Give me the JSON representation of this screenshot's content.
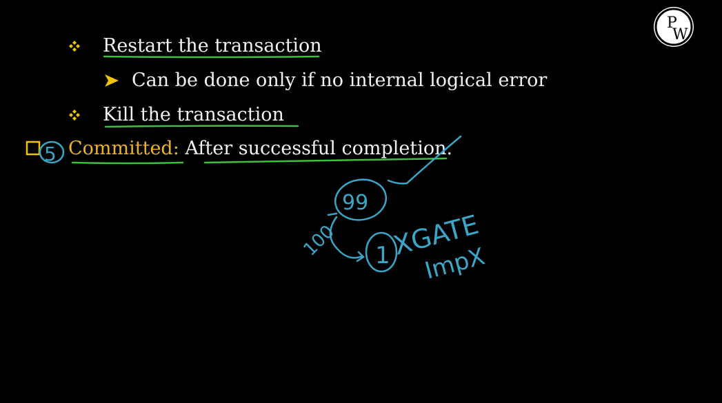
{
  "slide": {
    "items": [
      {
        "text": "Restart the transaction"
      },
      {
        "text": "Can be done only if no internal logical error"
      },
      {
        "text": "Kill the transaction"
      }
    ],
    "committed": {
      "label": "Committed:",
      "text": " After successful completion."
    }
  },
  "annotations": {
    "circled_number": "5",
    "num_start": "100",
    "num_circled": "99",
    "num_one": "1",
    "note1": "XGATE",
    "note2": "ImpX"
  },
  "logo": {
    "letter1": "P",
    "letter2": "W"
  },
  "colors": {
    "background": "#000000",
    "text": "#f2f2f2",
    "gold": "#f0b322",
    "bullet": "#f1c400",
    "underline": "#3fbf3f",
    "ink": "#3aa6c8"
  },
  "icons": {
    "bullet1": "diamond-cluster-bullet-icon",
    "bullet2": "arrow-bullet-icon",
    "logo": "pw-logo-icon"
  }
}
